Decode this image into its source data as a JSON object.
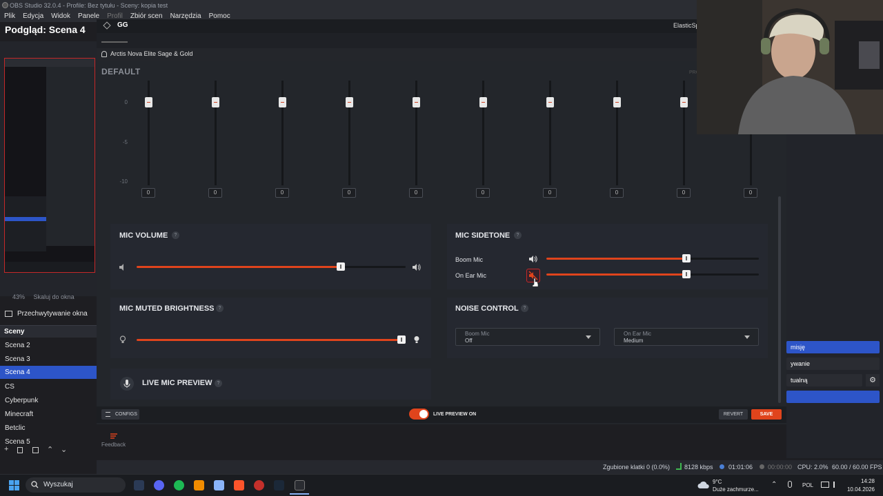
{
  "obs": {
    "title": "OBS Studio 32.0.4 - Profile: Bez tytułu - Sceny: kopia test",
    "menu": [
      "Plik",
      "Edycja",
      "Widok",
      "Panele",
      "Profil",
      "Zbiór scen",
      "Narzędzia",
      "Pomoc"
    ],
    "preview_title": "Podgląd: Scena 4",
    "zoom": "43%",
    "scale_label": "Skaluj do okna",
    "source_label": "Przechwytywanie okna",
    "scenes_header": "Sceny",
    "scenes": [
      {
        "label": "Scena 2",
        "active": false
      },
      {
        "label": "Scena 3",
        "active": false
      },
      {
        "label": "Scena 4",
        "active": true
      },
      {
        "label": "CS",
        "active": false
      },
      {
        "label": "Cyberpunk",
        "active": false
      },
      {
        "label": "Minecraft",
        "active": false
      },
      {
        "label": "Betclic",
        "active": false
      },
      {
        "label": "Scena 5",
        "active": false
      }
    ],
    "controls": {
      "start_streaming_suffix": "misję",
      "recording_suffix": "ywanie",
      "virtual_suffix": "tualną"
    },
    "status": {
      "dropped": "Zgubione klatki 0 (0.0%)",
      "bitrate": "8128 kbps",
      "stream_time": "01:01:06",
      "rec_time": "00:00:00",
      "cpu": "CPU: 2.0%",
      "fps": "60.00 / 60.00 FPS"
    }
  },
  "gg": {
    "app_title": "GG",
    "right_title": "ElasticSp",
    "device": "Arctis Nova Elite Sage & Gold",
    "preset": "DEFAULT",
    "preset_right": "PRO",
    "eq": {
      "axis_labels": [
        "0",
        "-5",
        "-10"
      ],
      "bands": [
        "0",
        "0",
        "0",
        "0",
        "0",
        "0",
        "0",
        "0",
        "0",
        "0"
      ]
    },
    "mic_volume": {
      "title": "MIC VOLUME",
      "help": "?",
      "value": 0.76
    },
    "mic_sidetone": {
      "title": "MIC SIDETONE",
      "help": "?",
      "rows": [
        {
          "label": "Boom Mic",
          "value": 0.66,
          "muted": false
        },
        {
          "label": "On Ear Mic",
          "value": 0.66,
          "muted": true
        }
      ]
    },
    "mic_muted_brightness": {
      "title": "MIC MUTED BRIGHTNESS",
      "help": "?",
      "value": 0.99
    },
    "noise_control": {
      "title": "NOISE CONTROL",
      "help": "?",
      "boom": {
        "label": "Boom Mic",
        "value": "Off"
      },
      "ear": {
        "label": "On Ear Mic",
        "value": "Medium"
      }
    },
    "live_mic_preview": {
      "title": "LIVE MIC PREVIEW",
      "help": "?"
    },
    "footer": {
      "configs": "CONFIGS",
      "live_preview": "LIVE PREVIEW ON",
      "revert": "REVERT",
      "save": "SAVE",
      "feedback": "Feedback"
    },
    "accent": "#e0441c"
  },
  "taskbar": {
    "search": "Wyszukaj",
    "weather_temp": "9°C",
    "weather_desc": "Duże zachmurze...",
    "lang": "POL",
    "time": "14:28",
    "date": "10.04.2026"
  }
}
